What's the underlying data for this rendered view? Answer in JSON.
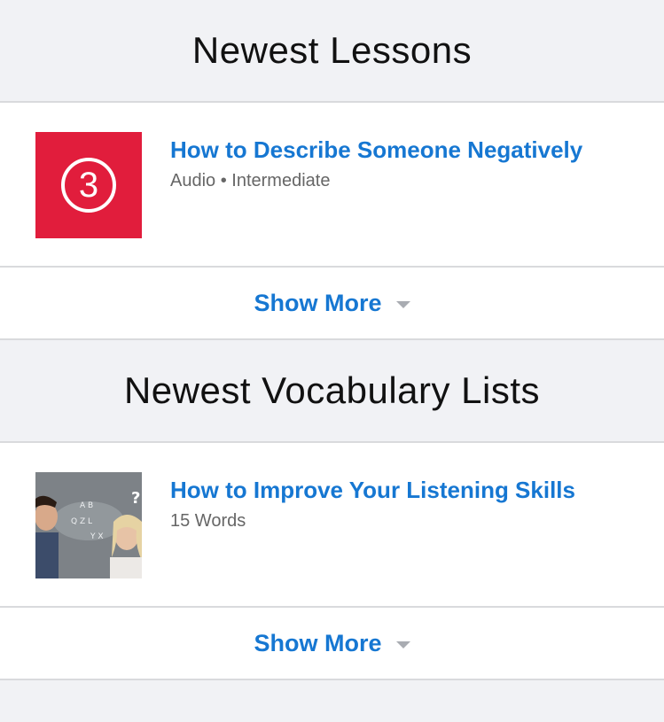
{
  "lessons": {
    "header": "Newest Lessons",
    "item": {
      "badge": "3",
      "title": "How to Describe Someone Negatively",
      "meta": "Audio • Intermediate"
    },
    "show_more": "Show More"
  },
  "vocabulary": {
    "header": "Newest Vocabulary Lists",
    "item": {
      "title": "How to Improve Your Listening Skills",
      "meta": "15 Words"
    },
    "show_more": "Show More"
  },
  "colors": {
    "accent": "#1677d2",
    "badge_bg": "#e11d3c",
    "page_bg": "#f1f2f5"
  },
  "icons": {
    "show_more": "chevron-down-icon",
    "lesson_thumb": "level-three-badge-icon"
  }
}
